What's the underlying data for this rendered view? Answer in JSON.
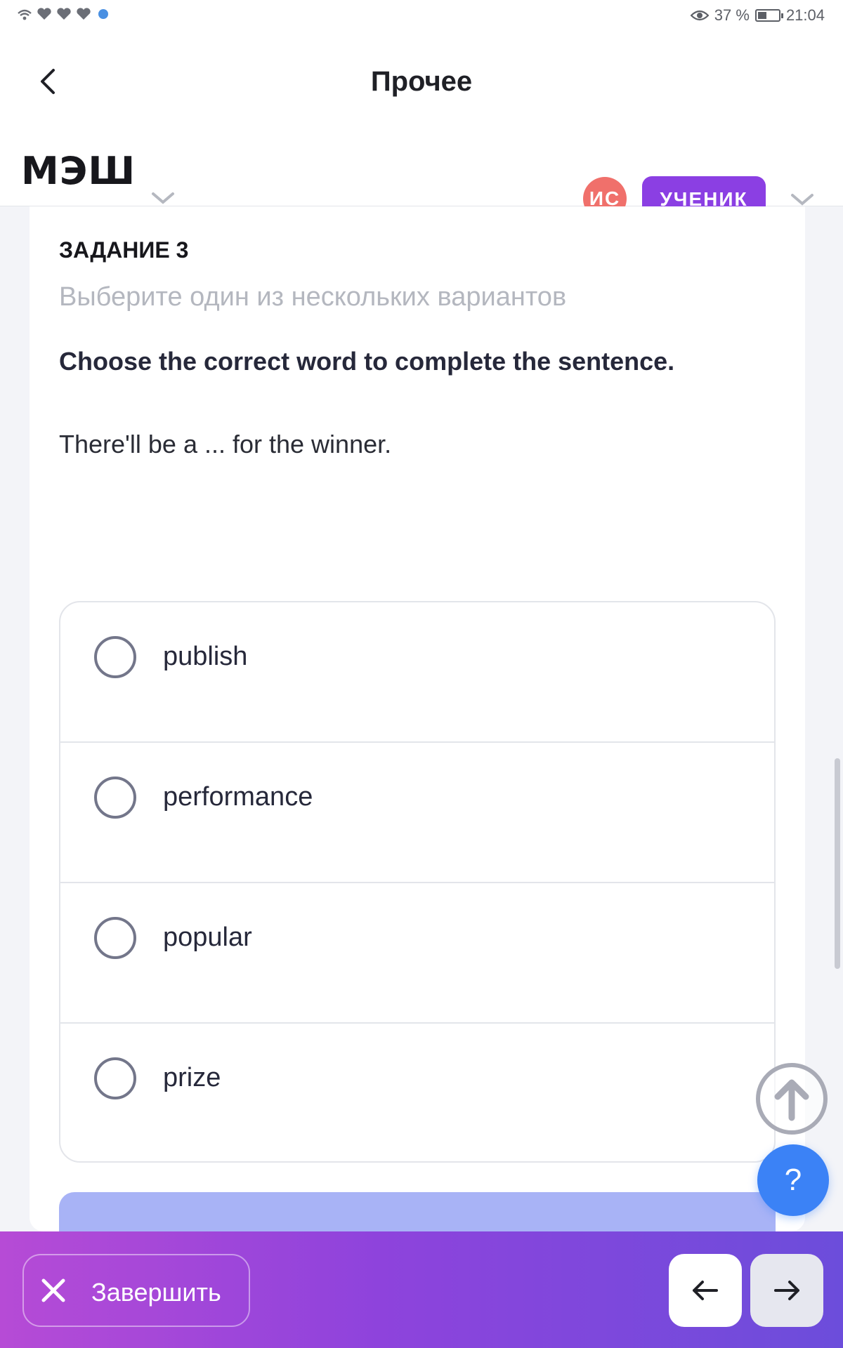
{
  "status_bar": {
    "battery_percent": "37 %",
    "time": "21:04"
  },
  "header": {
    "title": "Прочее",
    "logo": "МЭШ",
    "avatar_initials": "ИС",
    "role": "УЧЕНИК"
  },
  "task": {
    "label": "ЗАДАНИЕ 3",
    "hint": "Выберите один из нескольких вариантов",
    "question": "Choose the correct word to complete the sentence.",
    "sentence": "There'll be a ... for the winner.",
    "options": [
      {
        "label": "publish",
        "selected": false
      },
      {
        "label": "performance",
        "selected": false
      },
      {
        "label": "popular",
        "selected": false
      },
      {
        "label": "prize",
        "selected": false
      }
    ]
  },
  "help_button": "?",
  "bottom_bar": {
    "finish_label": "Завершить"
  },
  "colors": {
    "accent_purple": "#8b3fe3",
    "avatar_red": "#f0706b",
    "help_blue": "#3b82f6",
    "submit_peek": "#a8b3f6"
  },
  "icons": {
    "back": "chevron-left-icon",
    "dropdown": "chevron-down-icon",
    "scroll_top": "arrow-up-icon",
    "finish": "close-icon",
    "prev": "arrow-left-icon",
    "next": "arrow-right-icon"
  }
}
